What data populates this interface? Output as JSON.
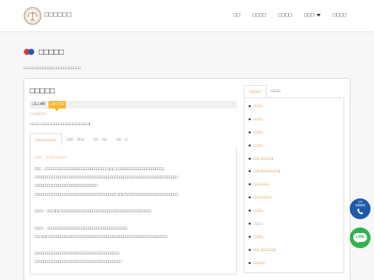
{
  "header": {
    "brand": "□□□□□□",
    "nav": [
      "□□",
      "□□□□",
      "□□□□",
      "□□□",
      "□□□□"
    ]
  },
  "page": {
    "title": "□□□□□",
    "breadcrumb": "□□□□,□□□□□□,□□,□□□□□,□□□□□□"
  },
  "law": {
    "title": "□□□□□",
    "article_range": "□1-□40",
    "article_badge": "□4-□71",
    "chapter": "□ □□□□ □",
    "subheading": "□□-□□-□□□□-□□□□□□□□□□□□□□□□)"
  },
  "left_tabs": [
    "□□□□□□□□□",
    "□□□　□□□",
    "□□　□□",
    "□□　□"
  ],
  "panel": {
    "subheading": "□□□　□□□□□□□□□",
    "lines": [
      "□□□　□□□□□□□□□□□□□□□□□□□□□□□□□□□□□ (□) □□□□□□□□□□□□□□□□□□□□□□□",
      "□□□□□□□□□□□□□□□□□□□□□□□□□□□□□□□□□□□□□□□□□□□□□□□□□□□□□□□□□□□□□□□□□□",
      "□□□□□□□□□□□□□□□□□□□□□□□□□□□□□",
      "□□□□□□□□□□□□□□□□□□□□□□□□□□□□□□□□□□□□□□ (□) □□□□□□□□□□□□□□□□□□□□□□□□□",
      "□□□□　□□□ (□) □□□□□□□□□□□□□□□□□□□□□□□□□□□□□□□□□□□□□□□□□□",
      "□□□□　□□□□□□□□□□□□□□□□□□□□□□□□□□□□□□□□□□□□□",
      "□□□ (□) □□□□□□□□□□□□□□□□□□□□□□□□□□□□□□□□□□□□□□□□□□□□□□□□□□□□□□□",
      "□□□□□□□□□□□□□□□□□□□□□□□□□□□□□□□□□□□□□□□",
      "□□□□□□□□□□□□□□□□□□□□□□□□□□□□□□□□□□□□□□□□"
    ]
  },
  "right_tabs": [
    "□□□□□",
    "□□□□"
  ],
  "right_items": [
    "□□□□",
    "□□□□",
    "□□□□",
    "□□□□",
    "□□□ (□□□□)",
    "□□□ (□□□□□□□)",
    "□□□□□□□",
    "□□□□□□□□",
    "□□□□",
    "□□□□",
    "□□□□",
    "□□□ (□□□□□)",
    "□□□□□"
  ],
  "float_phone": {
    "line1": "24H",
    "line2": "免費諮詢"
  },
  "float_line": {
    "label": "LINE"
  },
  "colors": {
    "accent": "#c06a18",
    "badge": "#f7b733",
    "phone": "#1d5aa8",
    "line": "#2fb44e"
  }
}
